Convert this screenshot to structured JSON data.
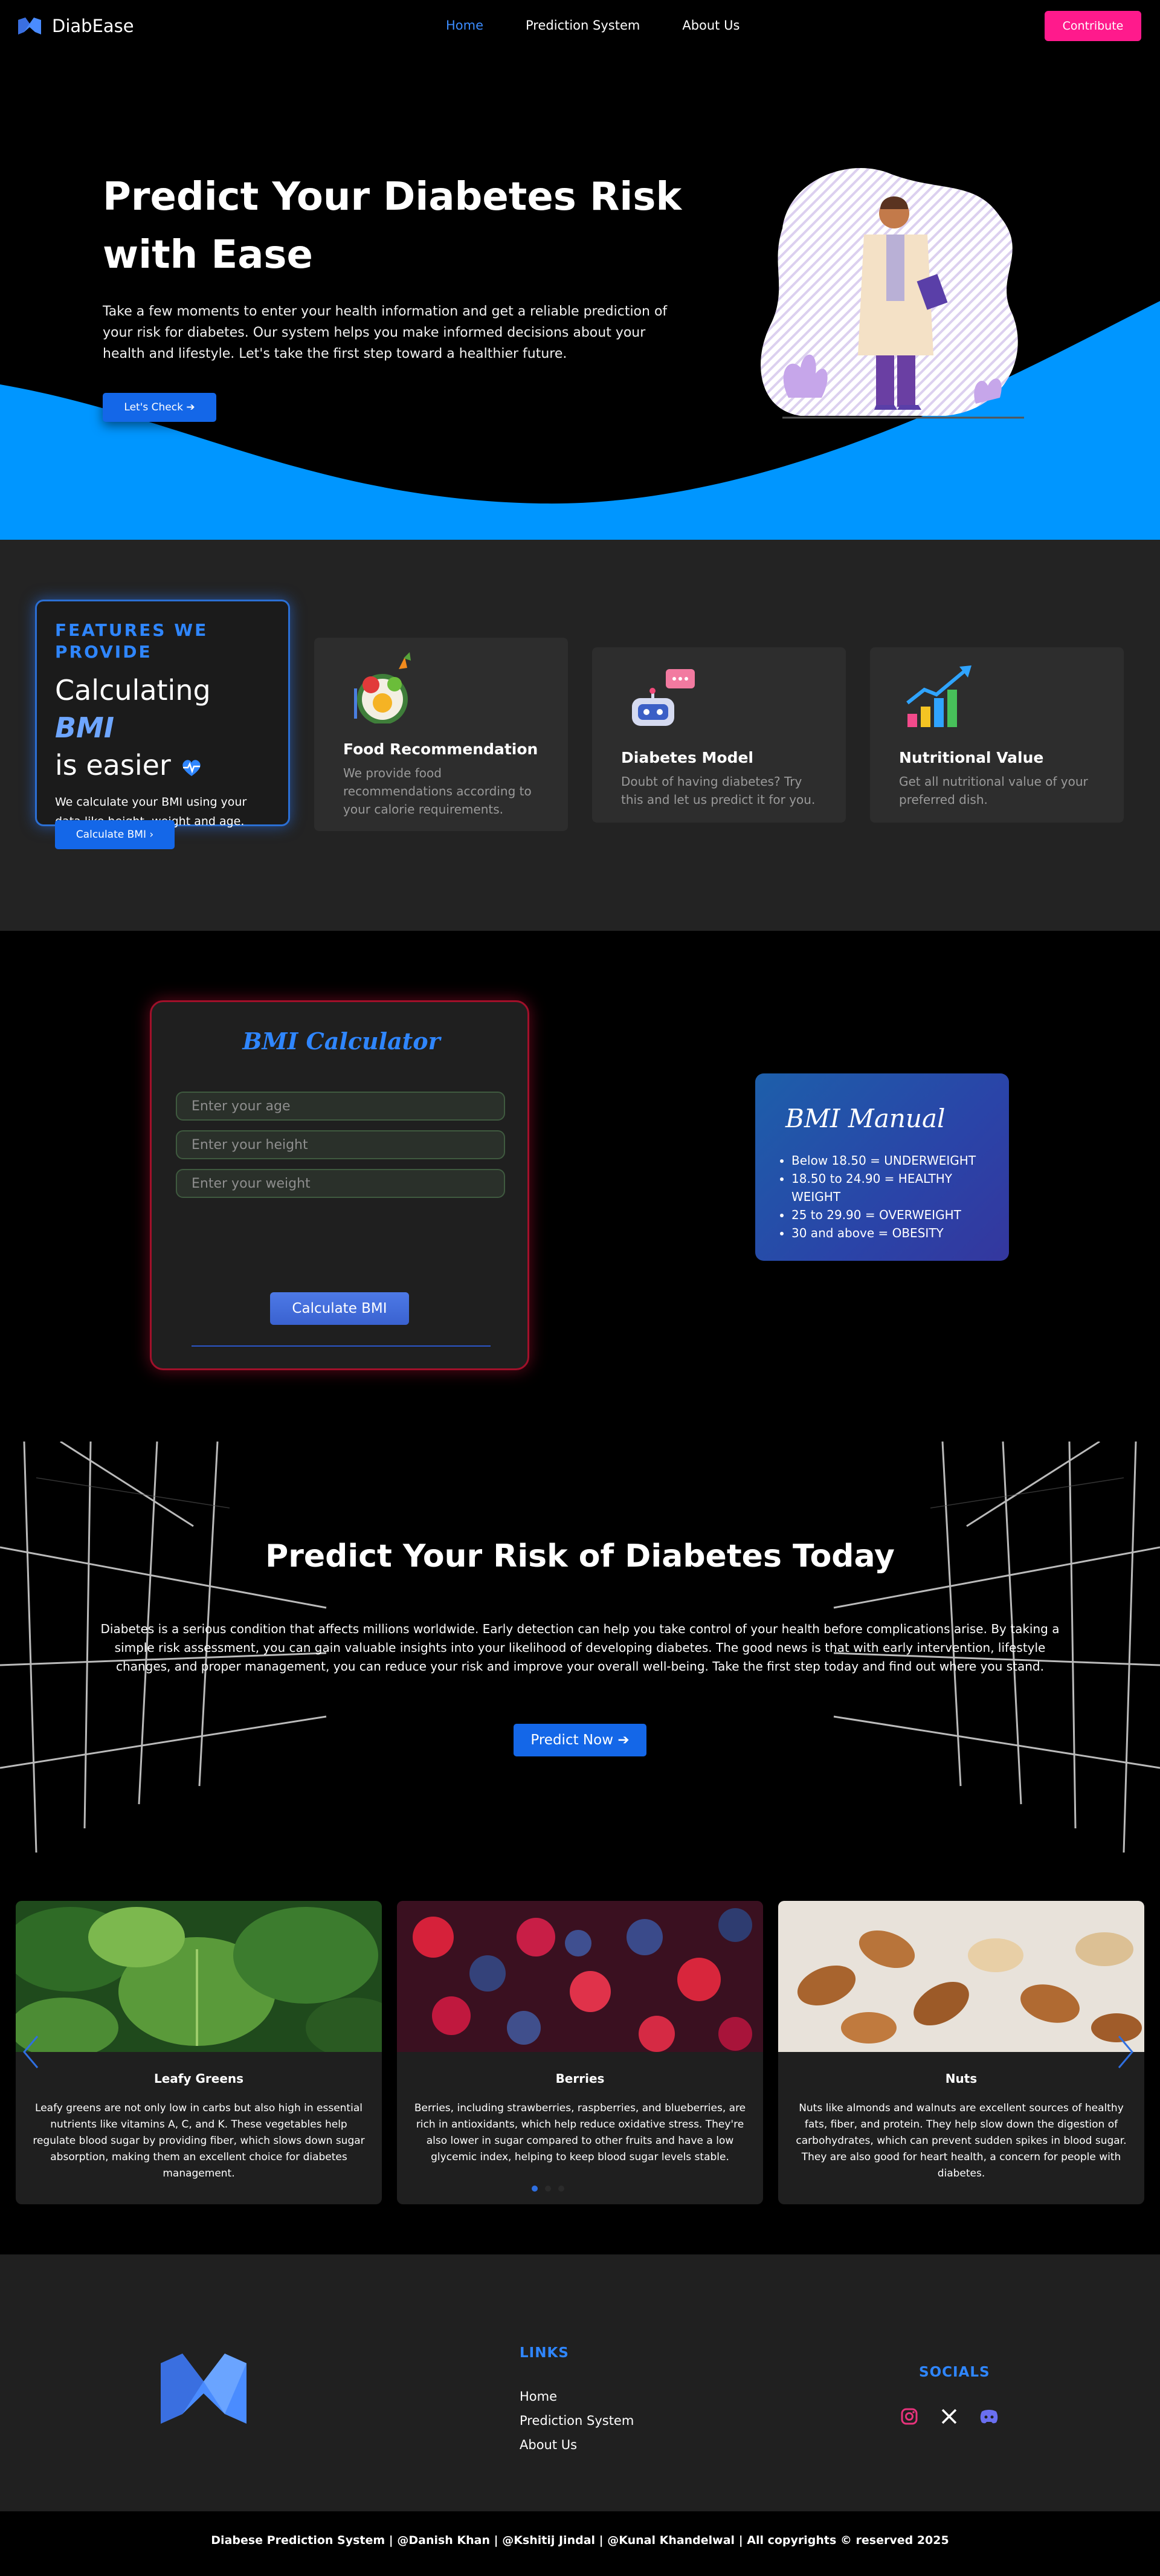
{
  "nav": {
    "brand": "DiabEase",
    "links": [
      "Home",
      "Prediction System",
      "About Us"
    ],
    "contribute": "Contribute"
  },
  "hero": {
    "title_line1": "Predict Your Diabetes Risk",
    "title_line2": "with Ease",
    "description": "Take a few moments to enter your health information and get a reliable prediction of your risk for diabetes. Our system helps you make informed decisions about your health and lifestyle. Let's take the first step toward a healthier future.",
    "button": "Let's Check ➔"
  },
  "features": {
    "kicker": "FEATURES WE PROVIDE",
    "heading_pre": "Calculating",
    "heading_bmi": "BMI",
    "heading_post": "is easier",
    "text": "We calculate your BMI using your data like height, weight and age.",
    "button": "Calculate BMI ›",
    "cards": [
      {
        "title": "Food Recommendation",
        "text": "We provide food recommendations according to your calorie requirements.",
        "icon": "food-bowl-icon"
      },
      {
        "title": "Diabetes Model",
        "text": "Doubt of having diabetes? Try this and let us predict it for you.",
        "icon": "robot-chat-icon"
      },
      {
        "title": "Nutritional Value",
        "text": "Get all nutritional value of your preferred dish.",
        "icon": "bar-chart-icon"
      }
    ]
  },
  "bmi": {
    "title": "BMI Calculator",
    "age_placeholder": "Enter your age",
    "height_placeholder": "Enter your height",
    "weight_placeholder": "Enter your weight",
    "button": "Calculate BMI",
    "manual_title": "BMI Manual",
    "manual_items": [
      "Below 18.50 = UNDERWEIGHT",
      "18.50 to 24.90 = HEALTHY WEIGHT",
      "25 to 29.90 = OVERWEIGHT",
      "30 and above = OBESITY"
    ]
  },
  "predict": {
    "title": "Predict Your Risk of Diabetes Today",
    "text": "Diabetes is a serious condition that affects millions worldwide. Early detection can help you take control of your health before complications arise. By taking a simple risk assessment, you can gain valuable insights into your likelihood of developing diabetes. The good news is that with early intervention, lifestyle changes, and proper management, you can reduce your risk and improve your overall well-being. Take the first step today and find out where you stand.",
    "button": "Predict Now ➔"
  },
  "foods": [
    {
      "name": "Leafy Greens",
      "text": "Leafy greens are not only low in carbs but also high in essential nutrients like vitamins A, C, and K. These vegetables help regulate blood sugar by providing fiber, which slows down sugar absorption, making them an excellent choice for diabetes management."
    },
    {
      "name": "Berries",
      "text": "Berries, including strawberries, raspberries, and blueberries, are rich in antioxidants, which help reduce oxidative stress. They're also lower in sugar compared to other fruits and have a low glycemic index, helping to keep blood sugar levels stable."
    },
    {
      "name": "Nuts",
      "text": "Nuts like almonds and walnuts are excellent sources of healthy fats, fiber, and protein. They help slow down the digestion of carbohydrates, which can prevent sudden spikes in blood sugar. They are also good for heart health, a concern for people with diabetes."
    }
  ],
  "footer": {
    "links_heading": "LINKS",
    "links": [
      "Home",
      "Prediction System",
      "About Us"
    ],
    "socials_heading": "SOCIALS",
    "socials": [
      "instagram-icon",
      "x-icon",
      "discord-icon"
    ],
    "copyright": "Diabese Prediction System | @Danish Khan | @Kshitij Jindal | @Kunal Khandelwal | All copyrights © reserved 2025"
  },
  "colors": {
    "accent": "#1467e8",
    "contribute": "#ff1a8c",
    "wave": "#0096ff"
  }
}
